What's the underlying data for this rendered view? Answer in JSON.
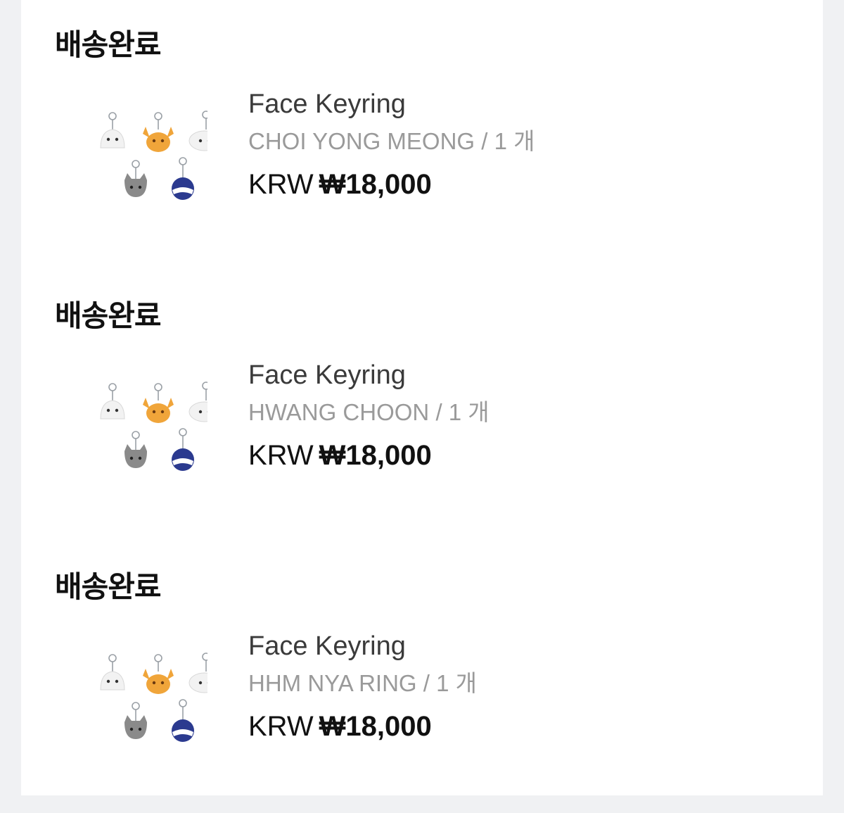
{
  "orders": [
    {
      "status": "배송완료",
      "product_name": "Face Keyring",
      "option": "CHOI YONG MEONG",
      "quantity": "/ 1 개",
      "currency": "KRW",
      "price": "₩18,000"
    },
    {
      "status": "배송완료",
      "product_name": "Face Keyring",
      "option": "HWANG CHOON",
      "quantity": "/ 1 개",
      "currency": "KRW",
      "price": "₩18,000"
    },
    {
      "status": "배송완료",
      "product_name": "Face Keyring",
      "option": "HHM NYA RING",
      "quantity": "/ 1 개",
      "currency": "KRW",
      "price": "₩18,000"
    }
  ],
  "colors": {
    "background": "#f0f1f3",
    "panel": "#ffffff",
    "status_text": "#111111",
    "name_text": "#3a3a3a",
    "option_text": "#9a9a9a",
    "keyring_white": "#f2f2f2",
    "keyring_orange": "#f0a53a",
    "keyring_gray": "#8a8a8a",
    "keyring_navy": "#2b3a8f"
  }
}
